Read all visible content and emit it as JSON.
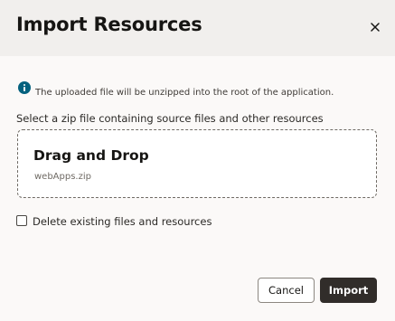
{
  "dialog": {
    "title": "Import Resources",
    "close_icon": "close-icon"
  },
  "info": {
    "icon": "info-icon",
    "icon_color": "#04617e",
    "text": "The uploaded file will be unzipped into the root of the application."
  },
  "select_label": "Select a zip file containing source files and other resources",
  "dropzone": {
    "title": "Drag and Drop",
    "file_name": "webApps.zip"
  },
  "delete_option": {
    "label": "Delete existing files and resources",
    "checked": false
  },
  "buttons": {
    "cancel": "Cancel",
    "import": "Import",
    "import_color": "#312d2a"
  }
}
